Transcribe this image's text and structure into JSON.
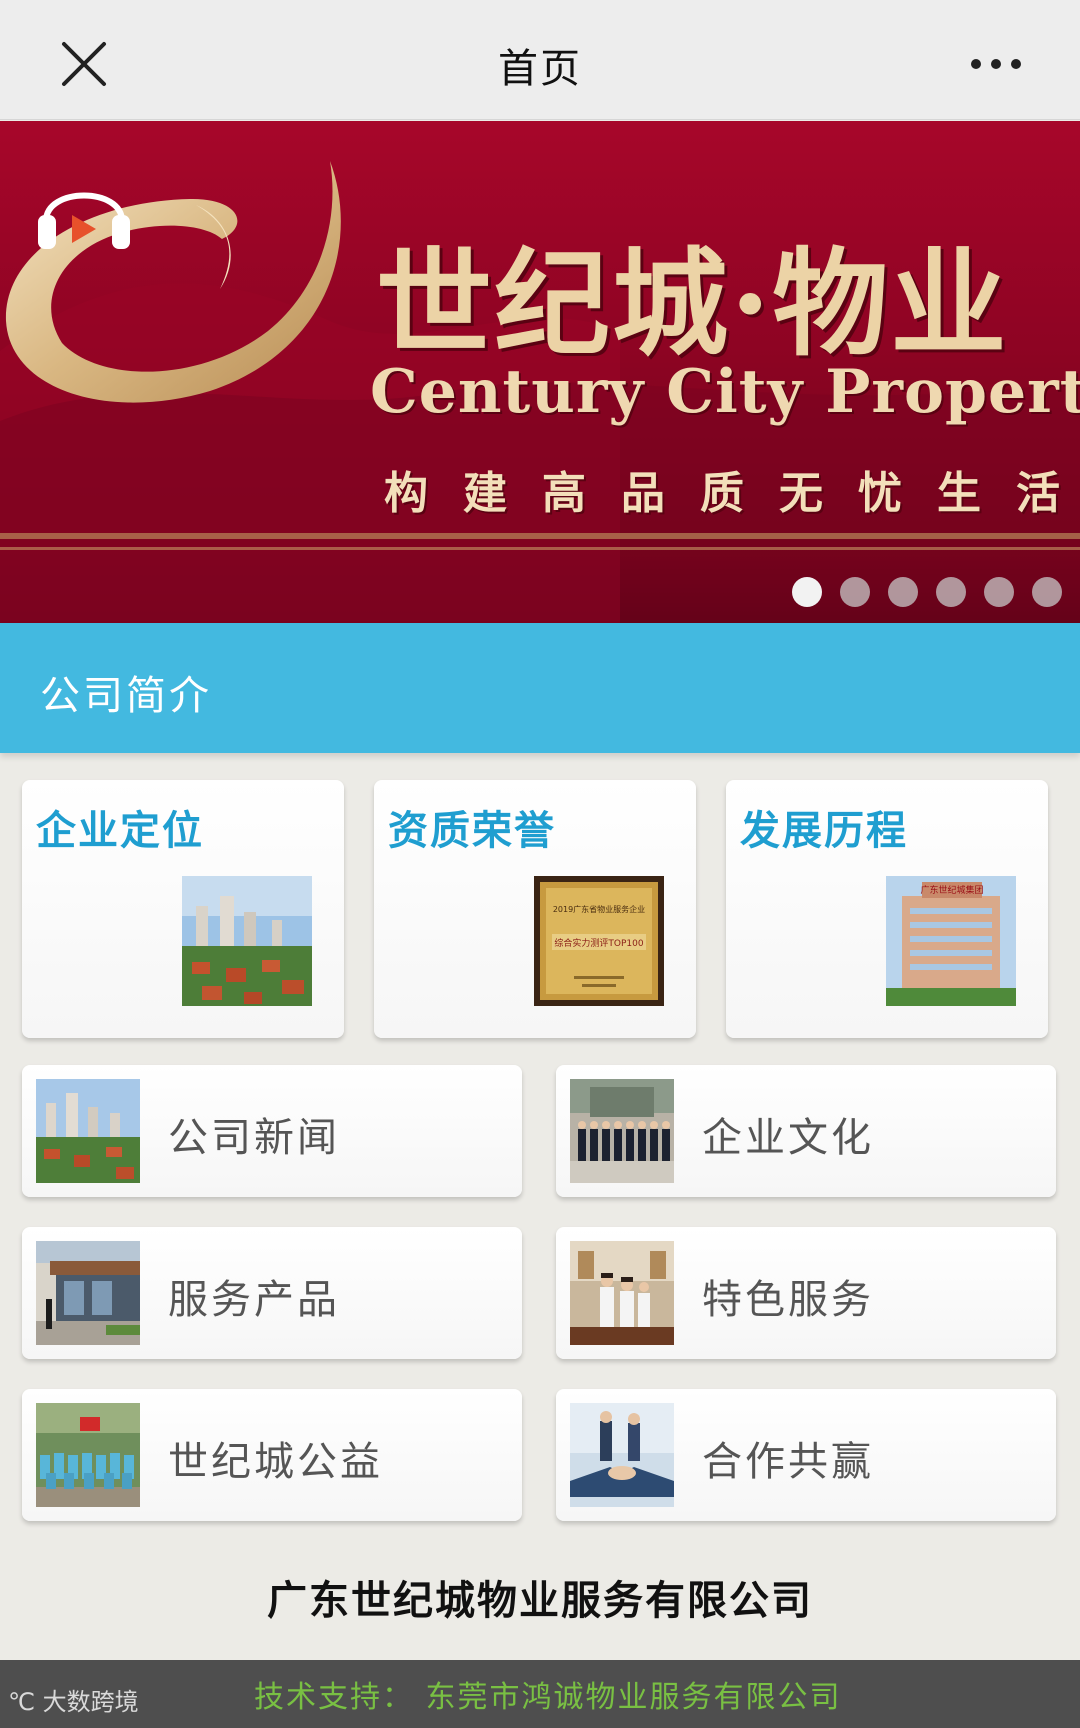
{
  "header": {
    "title": "首页",
    "close_icon": "close-icon",
    "more_icon": "more-dots-icon"
  },
  "banner": {
    "brand_cn": "世纪城·物业",
    "brand_en": "Century City Property",
    "slogan": "构建高品质无忧生活",
    "icon": "headphones-play-icon",
    "slide_count": 6,
    "active_slide": 1,
    "colors": {
      "background": "#8e0423",
      "gold": "#ecd3a6"
    }
  },
  "section": {
    "title": "公司简介",
    "color": "#43b9e0"
  },
  "tiles": [
    {
      "label": "企业定位",
      "image": "residential-towers-photo"
    },
    {
      "label": "资质荣誉",
      "image": "award-plaque-photo"
    },
    {
      "label": "发展历程",
      "image": "company-building-photo"
    }
  ],
  "plaque": {
    "line1": "2019广东省物业服务企业",
    "line2": "综合实力测评TOP100"
  },
  "building_sign": "广东世纪城集团",
  "menu": [
    {
      "label": "公司新闻",
      "image": "residential-towers-photo"
    },
    {
      "label": "企业文化",
      "image": "staff-group-photo"
    },
    {
      "label": "服务产品",
      "image": "building-entrance-photo"
    },
    {
      "label": "特色服务",
      "image": "service-staff-photo"
    },
    {
      "label": "世纪城公益",
      "image": "volunteer-group-photo"
    },
    {
      "label": "合作共赢",
      "image": "handshake-photo"
    }
  ],
  "footer": {
    "company": "广东世纪城物业服务有限公司",
    "support": "技术支持：  东莞市鸿诚物业服务有限公司",
    "watermark": "大数跨境"
  }
}
